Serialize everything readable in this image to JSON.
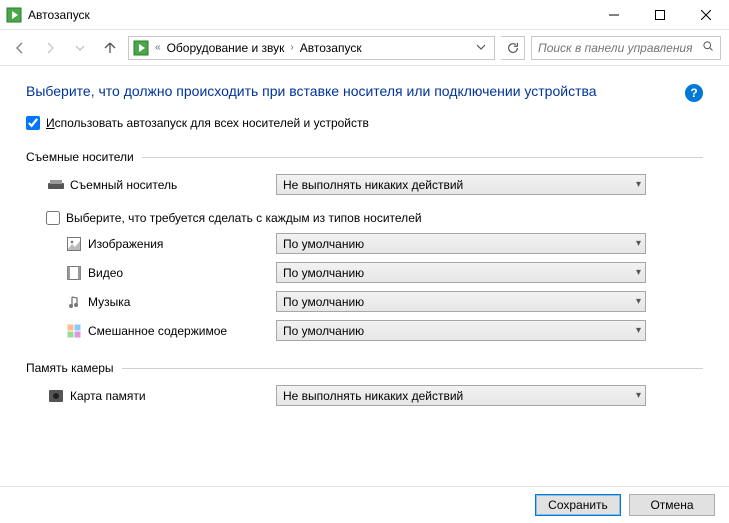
{
  "titlebar": {
    "title": "Автозапуск"
  },
  "nav": {
    "crumb1": "Оборудование и звук",
    "crumb2": "Автозапуск",
    "search_placeholder": "Поиск в панели управления"
  },
  "heading": "Выберите, что должно происходить при вставке носителя или подключении устройства",
  "global_checkbox": {
    "label": "Использовать автозапуск для всех носителей и устройств",
    "checked": true
  },
  "section_removable": {
    "title": "Съемные носители",
    "removable_label": "Съемный носитель",
    "removable_value": "Не выполнять никаких действий",
    "sub_check_label": "Выберите, что требуется сделать с каждым из типов носителей",
    "sub_check_checked": false,
    "items": [
      {
        "label": "Изображения",
        "value": "По умолчанию"
      },
      {
        "label": "Видео",
        "value": "По умолчанию"
      },
      {
        "label": "Музыка",
        "value": "По умолчанию"
      },
      {
        "label": "Смешанное содержимое",
        "value": "По умолчанию"
      }
    ]
  },
  "section_camera": {
    "title": "Память камеры",
    "card_label": "Карта памяти",
    "card_value": "Не выполнять никаких действий"
  },
  "buttons": {
    "save": "Сохранить",
    "cancel": "Отмена"
  }
}
